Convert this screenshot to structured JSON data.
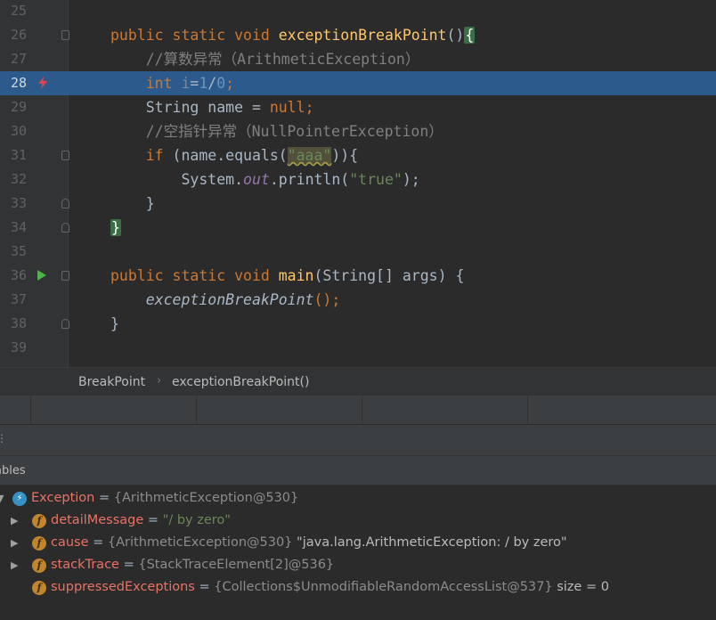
{
  "editor": {
    "lines": [
      {
        "num": "25",
        "tokens": []
      },
      {
        "num": "26",
        "tokens": [
          {
            "t": "public static void ",
            "c": "kw"
          },
          {
            "t": "exceptionBreakPoint",
            "c": "fn"
          },
          {
            "t": "()",
            "c": ""
          },
          {
            "t": "{",
            "c": "brace-hl"
          }
        ]
      },
      {
        "num": "27",
        "tokens": [
          {
            "t": "    //算数异常（ArithmeticException）",
            "c": "cm"
          }
        ]
      },
      {
        "num": "28",
        "tokens": [
          {
            "t": "    int ",
            "c": "kw"
          },
          {
            "t": "i",
            "c": "unused"
          },
          {
            "t": "=",
            "c": ""
          },
          {
            "t": "1",
            "c": "num"
          },
          {
            "t": "/",
            "c": ""
          },
          {
            "t": "0",
            "c": "num"
          },
          {
            "t": ";",
            "c": "kw"
          }
        ]
      },
      {
        "num": "29",
        "tokens": [
          {
            "t": "    String name = ",
            "c": ""
          },
          {
            "t": "null",
            "c": "kw"
          },
          {
            "t": ";",
            "c": "kw"
          }
        ]
      },
      {
        "num": "30",
        "tokens": [
          {
            "t": "    //空指针异常（NullPointerException）",
            "c": "cm"
          }
        ]
      },
      {
        "num": "31",
        "tokens": [
          {
            "t": "    if ",
            "c": "kw"
          },
          {
            "t": "(name.equals(",
            "c": ""
          },
          {
            "t": "\"aaa\"",
            "c": "str str-hl"
          },
          {
            "t": ")){",
            "c": ""
          }
        ]
      },
      {
        "num": "32",
        "tokens": [
          {
            "t": "        System.",
            "c": ""
          },
          {
            "t": "out",
            "c": "fld"
          },
          {
            "t": ".println(",
            "c": ""
          },
          {
            "t": "\"true\"",
            "c": "str"
          },
          {
            "t": ");",
            "c": ""
          }
        ]
      },
      {
        "num": "33",
        "tokens": [
          {
            "t": "    }",
            "c": ""
          }
        ]
      },
      {
        "num": "34",
        "tokens": [
          {
            "t": "}",
            "c": "brace-hl"
          }
        ]
      },
      {
        "num": "35",
        "tokens": []
      },
      {
        "num": "36",
        "tokens": [
          {
            "t": "public static void ",
            "c": "kw"
          },
          {
            "t": "main",
            "c": "fn"
          },
          {
            "t": "(String[] args) {",
            "c": ""
          }
        ]
      },
      {
        "num": "37",
        "tokens": [
          {
            "t": "    exceptionBreakPoint",
            "c": "ital"
          },
          {
            "t": "();",
            "c": "kw"
          }
        ]
      },
      {
        "num": "38",
        "tokens": [
          {
            "t": "}",
            "c": ""
          }
        ]
      },
      {
        "num": "39",
        "tokens": []
      }
    ],
    "highlighted_line": "28",
    "gutter_icons": {
      "28": "exception-breakpoint-icon",
      "36": "run-icon"
    }
  },
  "breadcrumb": {
    "items": [
      "BreakPoint",
      "exceptionBreakPoint()"
    ],
    "separator": "›"
  },
  "toolbar": {
    "glyph": "⋮"
  },
  "variables_panel": {
    "header": "ables",
    "rows": [
      {
        "name": "Exception",
        "type": "{ArithmeticException@530}",
        "value": "",
        "extra": "",
        "icon": "exception-icon",
        "expanded": true
      },
      {
        "name": "detailMessage",
        "type": "",
        "value": "\"/ by zero\"",
        "extra": "",
        "icon": "field-icon",
        "expanded": false
      },
      {
        "name": "cause",
        "type": "{ArithmeticException@530}",
        "value": "\"java.lang.ArithmeticException: / by zero\"",
        "extra": "",
        "icon": "field-icon",
        "expanded": false
      },
      {
        "name": "stackTrace",
        "type": "{StackTraceElement[2]@536}",
        "value": "",
        "extra": "",
        "icon": "field-icon",
        "expanded": false
      },
      {
        "name": "suppressedExceptions",
        "type": "{Collections$UnmodifiableRandomAccessList@537}",
        "value": "",
        "extra": "size = 0",
        "icon": "field-icon",
        "expanded": false
      }
    ]
  }
}
